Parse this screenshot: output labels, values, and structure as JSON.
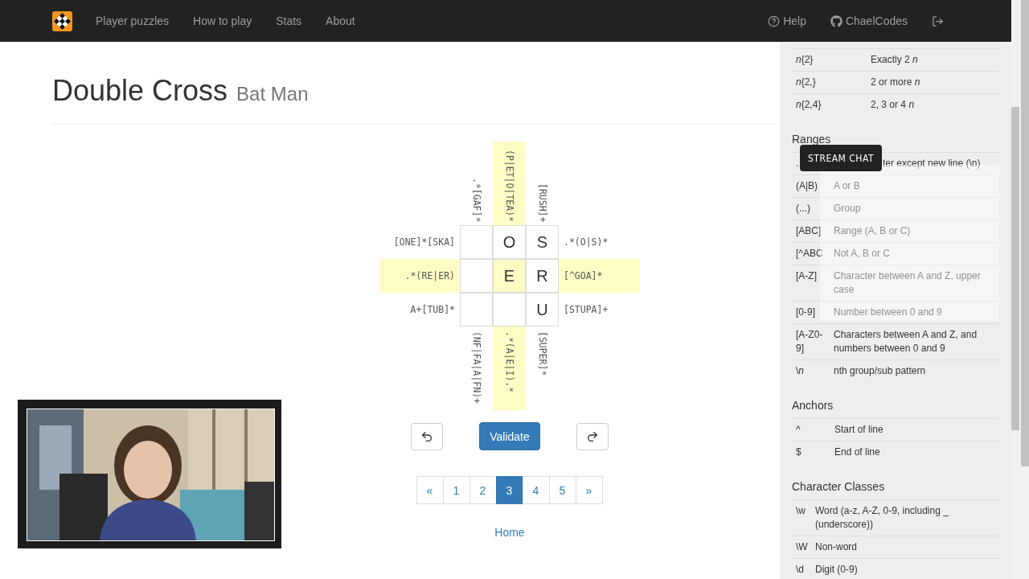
{
  "navbar": {
    "items": [
      {
        "label": "Player puzzles"
      },
      {
        "label": "How to play"
      },
      {
        "label": "Stats"
      },
      {
        "label": "About"
      }
    ],
    "right_items": [
      {
        "kind": "help",
        "label": "Help"
      },
      {
        "kind": "github",
        "label": "ChaelCodes"
      },
      {
        "kind": "exit"
      }
    ]
  },
  "title": "Double Cross",
  "subtitle": "Bat Man",
  "puzzle": {
    "top_clues": [
      ".*[GAF]*",
      "(P|ET|O|TEA)*",
      "[RUSH]+"
    ],
    "bottom_clues": [
      "(NF|FA|A|FN)+",
      ".*(A|E|I).*",
      "[SUPER]*"
    ],
    "left_clues": [
      "[ONE]*[SKA]",
      ".*(RE|ER)",
      "A+[TUB]*"
    ],
    "right_clues": [
      ".*(O|S)*",
      "[^GOA]*",
      "[STUPA]+"
    ],
    "rows": [
      [
        {
          "selected": false
        },
        {
          "value": "O",
          "selected": false
        },
        {
          "value": "S",
          "selected": false
        }
      ],
      [
        {
          "selected": false
        },
        {
          "value": "E",
          "selected": true
        },
        {
          "value": "R",
          "selected": false
        }
      ],
      [
        {
          "selected": false
        },
        {
          "selected": false
        },
        {
          "value": "U",
          "selected": false
        }
      ]
    ]
  },
  "validate_label": "Validate",
  "pagination": [
    {
      "label": "«",
      "selected": false
    },
    {
      "label": "1",
      "selected": false
    },
    {
      "label": "2",
      "selected": false
    },
    {
      "label": "3",
      "selected": true
    },
    {
      "label": "4",
      "selected": false
    },
    {
      "label": "5",
      "selected": false
    },
    {
      "label": "»",
      "selected": false
    }
  ],
  "home_link": "Home",
  "sidebar": {
    "sections": [
      {
        "rows": [
          {
            "key": "*n*{2}",
            "desc": "Exactly 2 *n*"
          },
          {
            "key": "*n*{2,}",
            "desc": "2 or more *n*"
          },
          {
            "key": "*n*{2,4}",
            "desc": "2, 3 or 4 *n*"
          }
        ]
      },
      {
        "heading": "Ranges",
        "rows": [
          {
            "key": ".",
            "desc": "ter except new line (\\n)",
            "kind": "partly_hidden"
          },
          {
            "key": "(A|B)",
            "desc": "A or B"
          },
          {
            "key": "(...)",
            "desc": "Group"
          },
          {
            "key": "[ABC]",
            "desc": "Range (A, B or C)"
          },
          {
            "key": "[^ABC",
            "desc": "Not A, B or C"
          },
          {
            "key": "[A-Z]",
            "desc": "Character between A and Z, upper case"
          },
          {
            "key": "[0-9]",
            "desc": "Number between 0 and 9"
          },
          {
            "key": "[A-Z0-9]",
            "desc": "Characters between A and Z, and numbers between 0 and 9"
          },
          {
            "key": "\\*n*",
            "desc": "nth group/sub pattern"
          }
        ]
      },
      {
        "heading": "Anchors",
        "rows": [
          {
            "key": "^",
            "desc": "Start of line"
          },
          {
            "key": "$",
            "desc": "End of line"
          }
        ]
      },
      {
        "heading": "Character Classes",
        "rows": [
          {
            "key": "\\w",
            "desc": "Word (a-z, A-Z, 0-9, including _ (underscore))"
          },
          {
            "key": "\\W",
            "desc": "Non-word"
          },
          {
            "key": "\\d",
            "desc": "Digit (0-9)"
          }
        ]
      }
    ]
  },
  "stream_overlay": {
    "chat_label": "STREAM CHAT"
  }
}
